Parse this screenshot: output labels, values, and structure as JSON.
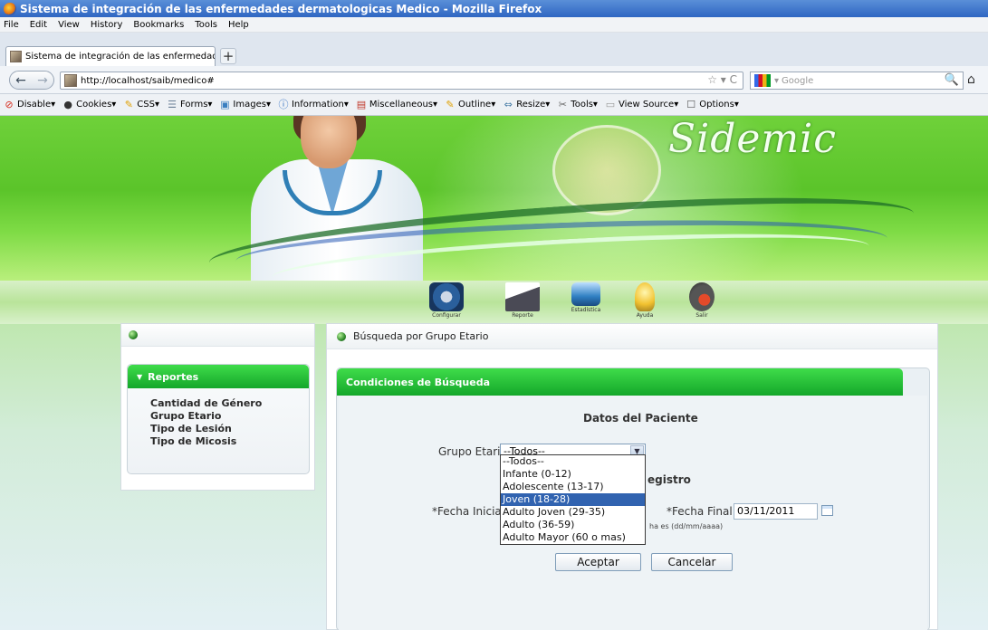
{
  "window": {
    "title": "Sistema de integración de las enfermedades dermatologicas Medico - Mozilla Firefox"
  },
  "menu": [
    "File",
    "Edit",
    "View",
    "History",
    "Bookmarks",
    "Tools",
    "Help"
  ],
  "tab": {
    "title": "Sistema de integración de las enfermedades ...",
    "new_tab": "+"
  },
  "nav": {
    "back": "←",
    "forward": "→",
    "url": "http://localhost/saib/medico#",
    "url_right": "☆ ▾ C",
    "search_placeholder": "Google",
    "search_engine_arrow": "▾",
    "search_icon": "🔍",
    "home_icon": "⌂"
  },
  "devtools": [
    {
      "label": "Disable▾",
      "icon": "⊘",
      "color": "#d62b1e"
    },
    {
      "label": "Cookies▾",
      "icon": "●",
      "color": "#333"
    },
    {
      "label": "CSS▾",
      "icon": "✎",
      "color": "#e0a000"
    },
    {
      "label": "Forms▾",
      "icon": "☰",
      "color": "#6a7f96"
    },
    {
      "label": "Images▾",
      "icon": "▣",
      "color": "#3a7fc0"
    },
    {
      "label": "Information▾",
      "icon": "ⓘ",
      "color": "#2f6fc2"
    },
    {
      "label": "Miscellaneous▾",
      "icon": "▤",
      "color": "#c0392b"
    },
    {
      "label": "Outline▾",
      "icon": "✎",
      "color": "#e0a000"
    },
    {
      "label": "Resize▾",
      "icon": "⇔",
      "color": "#4a7fa8"
    },
    {
      "label": "Tools▾",
      "icon": "✂",
      "color": "#666"
    },
    {
      "label": "View Source▾",
      "icon": "▭",
      "color": "#999"
    },
    {
      "label": "Options▾",
      "icon": "☐",
      "color": "#555"
    }
  ],
  "banner": {
    "logo": "Sidemic"
  },
  "top_nav": [
    {
      "label": "Configurar",
      "color": "#2a5f9c",
      "icon": "gear-icon"
    },
    {
      "label": "Reporte",
      "color": "#4a4a55",
      "icon": "report-icon"
    },
    {
      "label": "Estadística",
      "color": "#2f7fc2",
      "icon": "statistics-icon"
    },
    {
      "label": "Ayuda",
      "color": "#f2c230",
      "icon": "help-bulb-icon"
    },
    {
      "label": "Salir",
      "color": "#555",
      "icon": "exit-icon"
    }
  ],
  "sidebar": {
    "section": "Reportes",
    "items": [
      "Cantidad de Género",
      "Grupo Etario",
      "Tipo de Lesión",
      "Tipo de Micosis"
    ]
  },
  "main": {
    "title": "Búsqueda por Grupo Etario",
    "section": "Condiciones de Búsqueda",
    "patient_title": "Datos del Paciente",
    "grupo_label": "Grupo Etario:",
    "grupo_value": "--Todos--",
    "grupo_options": [
      "--Todos--",
      "Infante (0-12)",
      "Adolescente (13-17)",
      "Joven (18-28)",
      "Adulto Joven (29-35)",
      "Adulto (36-59)",
      "Adulto Mayor (60 o mas)"
    ],
    "grupo_highlighted_index": 3,
    "registro_partial": "egistro",
    "fecha_inicial_label": "*Fecha Inicial:",
    "fecha_final_label": "*Fecha Final:",
    "fecha_final_value": "03/11/2011",
    "format_hint_partial": "ha es (dd/mm/aaaa)",
    "accept": "Aceptar",
    "cancel": "Cancelar"
  },
  "colors": {
    "accent_green": "#1fb833",
    "highlight_blue": "#3163b0",
    "title_blue": "#2f66c2"
  }
}
